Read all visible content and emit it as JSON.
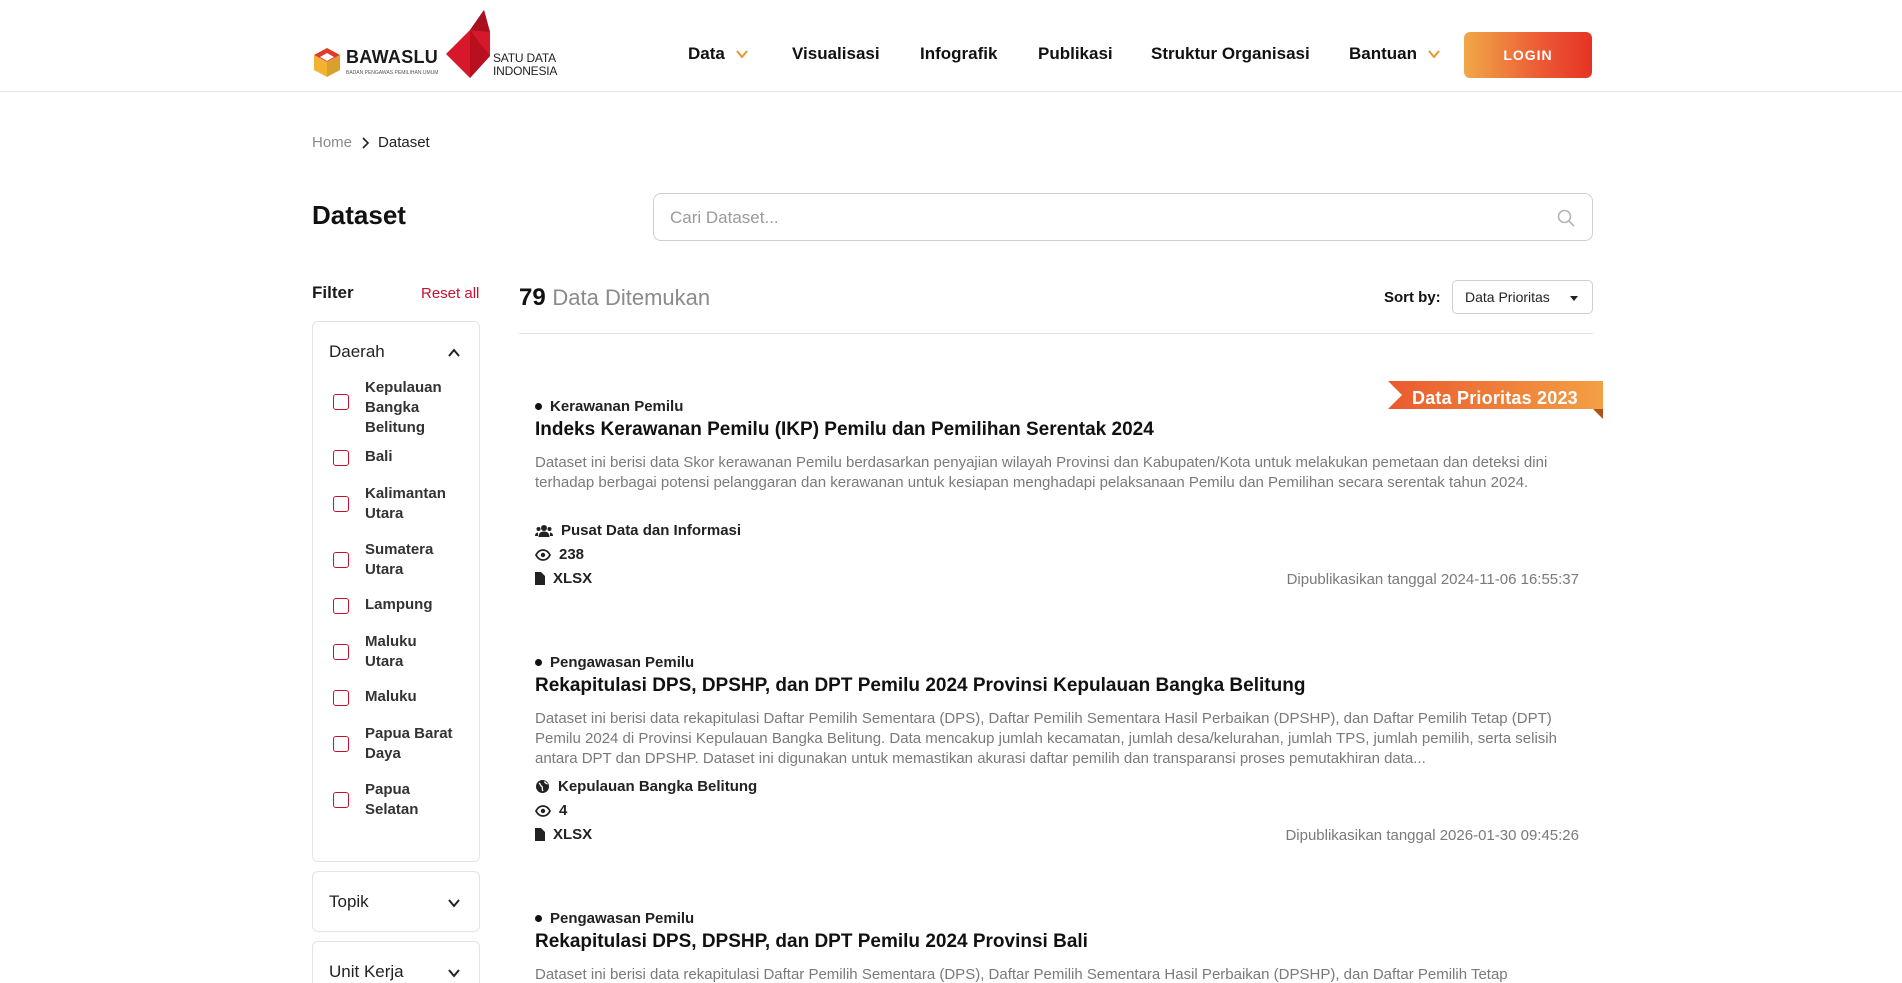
{
  "header": {
    "brand_bawaslu": "BAWASLU",
    "brand_bawaslu_sub": "BADAN PENGAWAS PEMILIHAN UMUM",
    "brand_sdi_line1": "SATU DATA",
    "brand_sdi_line2": "INDONESIA",
    "nav": [
      {
        "label": "Data",
        "has_dropdown": true
      },
      {
        "label": "Visualisasi",
        "has_dropdown": false
      },
      {
        "label": "Infografik",
        "has_dropdown": false
      },
      {
        "label": "Publikasi",
        "has_dropdown": false
      },
      {
        "label": "Struktur Organisasi",
        "has_dropdown": false
      },
      {
        "label": "Bantuan",
        "has_dropdown": true
      }
    ],
    "login_label": "LOGIN"
  },
  "breadcrumb": {
    "home": "Home",
    "current": "Dataset"
  },
  "page": {
    "title": "Dataset",
    "search_placeholder": "Cari Dataset..."
  },
  "filter": {
    "label": "Filter",
    "reset_label": "Reset all",
    "daerah": {
      "title": "Daerah",
      "expanded": true,
      "items": [
        {
          "label": "Kepulauan Bangka Belitung",
          "checked": false
        },
        {
          "label": "Bali",
          "checked": false
        },
        {
          "label": "Kalimantan Utara",
          "checked": false
        },
        {
          "label": "Sumatera Utara",
          "checked": false
        },
        {
          "label": "Lampung",
          "checked": false
        },
        {
          "label": "Maluku Utara",
          "checked": false
        },
        {
          "label": "Maluku",
          "checked": false
        },
        {
          "label": "Papua Barat Daya",
          "checked": false
        },
        {
          "label": "Papua Selatan",
          "checked": false
        }
      ]
    },
    "topik": {
      "title": "Topik",
      "expanded": false
    },
    "unit_kerja": {
      "title": "Unit Kerja",
      "expanded": false
    }
  },
  "results": {
    "count": "79",
    "count_label": "Data Ditemukan",
    "sort_label": "Sort by:",
    "sort_value": "Data Prioritas",
    "priority_ribbon": "Data Prioritas 2023",
    "items": [
      {
        "category": "Kerawanan Pemilu",
        "title": "Indeks Kerawanan Pemilu (IKP) Pemilu dan Pemilihan Serentak 2024",
        "description": "Dataset ini berisi data Skor kerawanan Pemilu berdasarkan penyajian wilayah Provinsi dan Kabupaten/Kota untuk melakukan pemetaan dan deteksi dini terhadap berbagai potensi pelanggaran dan kerawanan untuk kesiapan menghadapi pelaksanaan Pemilu dan Pemilihan secara serentak tahun 2024.",
        "source_icon": "users-icon",
        "source": "Pusat Data dan Informasi",
        "views": "238",
        "format": "XLSX",
        "published": "Dipublikasikan tanggal 2024-11-06 16:55:37",
        "priority": true
      },
      {
        "category": "Pengawasan Pemilu",
        "title": "Rekapitulasi DPS, DPSHP, dan DPT Pemilu 2024 Provinsi Kepulauan Bangka Belitung",
        "description": "Dataset ini berisi data rekapitulasi Daftar Pemilih Sementara (DPS), Daftar Pemilih Sementara Hasil Perbaikan (DPSHP), dan Daftar Pemilih Tetap (DPT) Pemilu 2024 di Provinsi Kepulauan Bangka Belitung. Data mencakup jumlah kecamatan, jumlah desa/kelurahan, jumlah TPS, jumlah pemilih, serta selisih antara DPT dan DPSHP. Dataset ini digunakan untuk memastikan akurasi daftar pemilih dan transparansi proses pemutakhiran data...",
        "source_icon": "globe-icon",
        "source": "Kepulauan Bangka Belitung",
        "views": "4",
        "format": "XLSX",
        "published": "Dipublikasikan tanggal 2026-01-30 09:45:26",
        "priority": false
      },
      {
        "category": "Pengawasan Pemilu",
        "title": "Rekapitulasi DPS, DPSHP, dan DPT Pemilu 2024 Provinsi Bali",
        "description": "Dataset ini berisi data rekapitulasi Daftar Pemilih Sementara (DPS), Daftar Pemilih Sementara Hasil Perbaikan (DPSHP), dan Daftar Pemilih Tetap",
        "priority": false
      }
    ]
  },
  "colors": {
    "accent_red": "#c8102e",
    "login_gradient_start": "#f0a848",
    "login_gradient_end": "#e63324",
    "nav_chevron": "#e8962e"
  }
}
